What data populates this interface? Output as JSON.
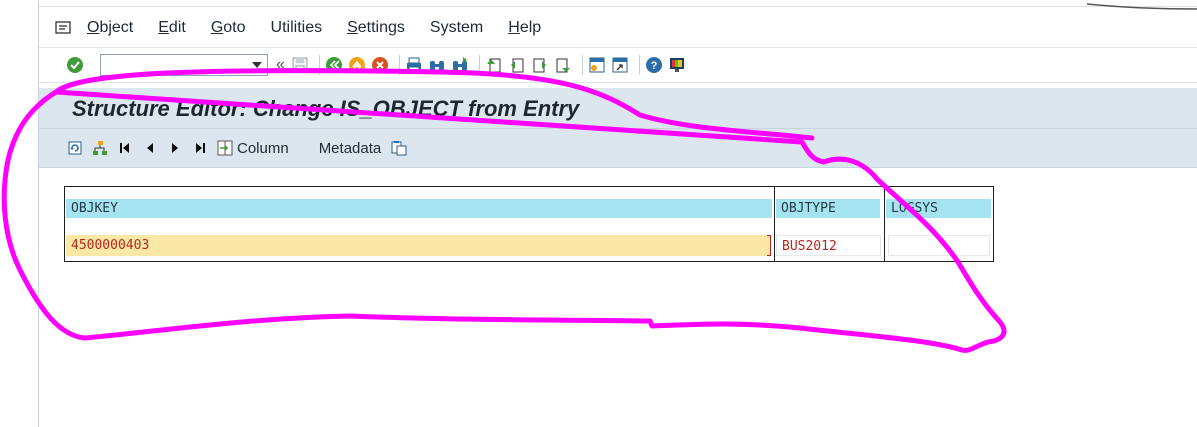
{
  "menu": {
    "items": [
      {
        "accel": "O",
        "rest": "bject"
      },
      {
        "accel": "E",
        "rest": "dit"
      },
      {
        "accel": "G",
        "rest": "oto"
      },
      {
        "accel": "",
        "rest": "Utilities"
      },
      {
        "accel": "S",
        "rest": "ettings"
      },
      {
        "accel": "",
        "rest": "System"
      },
      {
        "accel": "H",
        "rest": "elp"
      }
    ]
  },
  "toolbar": {
    "command_field_value": "",
    "chevron": "«"
  },
  "screen": {
    "title": "Structure Editor: Change IS_OBJECT from Entry"
  },
  "app_toolbar": {
    "column_label": "Column",
    "metadata_label": "Metadata"
  },
  "table": {
    "headers": [
      "OBJKEY",
      "OBJTYPE",
      "LOGSYS"
    ],
    "row": [
      "4500000403",
      "BUS2012",
      ""
    ]
  },
  "colors": {
    "header_bg": "#a6e3f1",
    "focus_bg": "#fbe8a6",
    "value_text": "#b8261e",
    "title_bar_bg": "#dce6ee",
    "annotation_stroke": "#ff00ff"
  }
}
